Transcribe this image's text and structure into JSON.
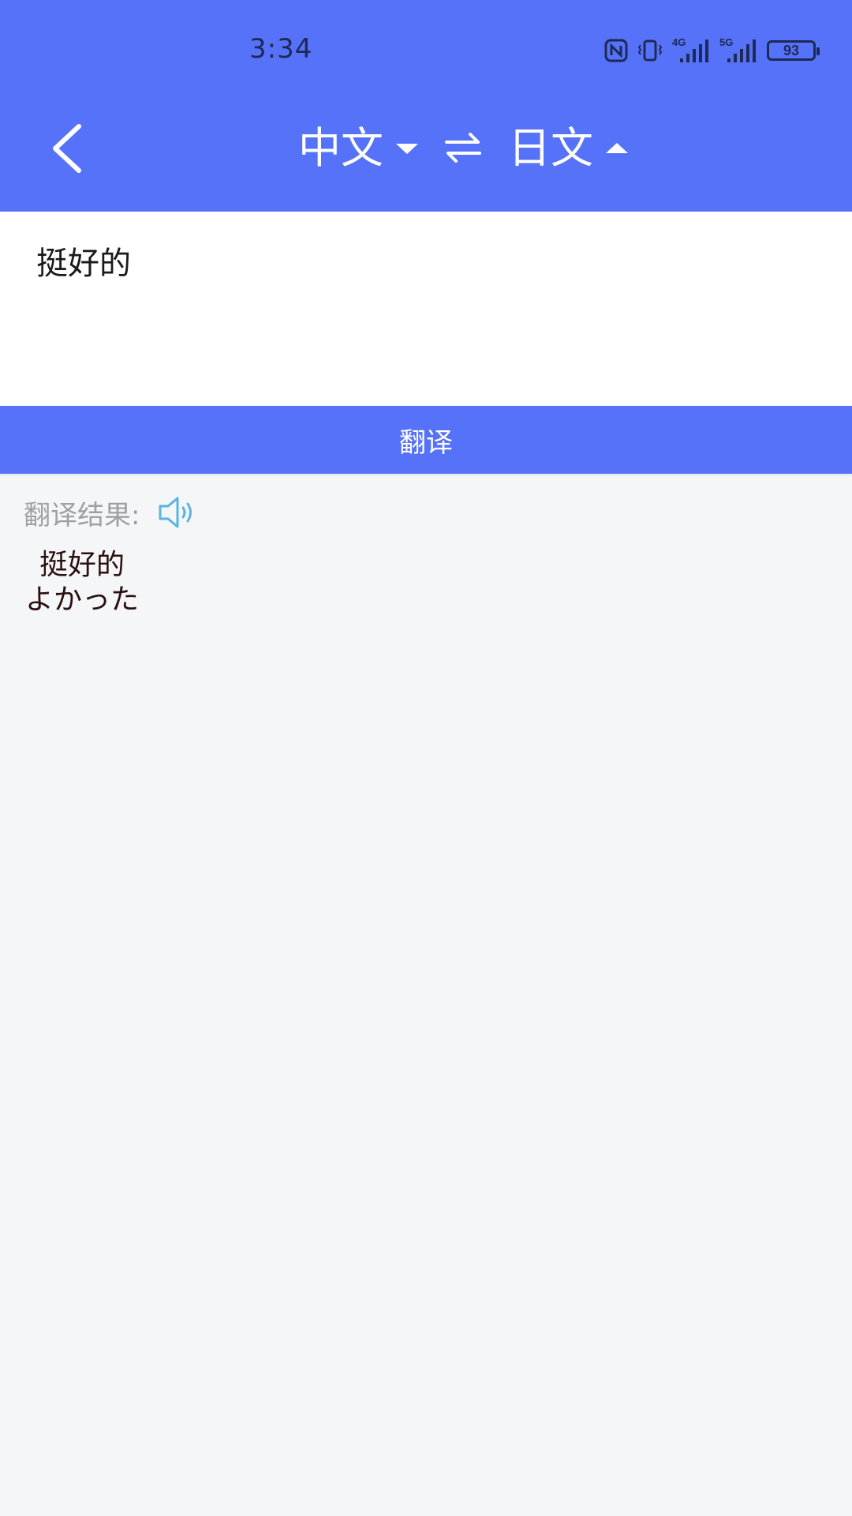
{
  "status_bar": {
    "time": "3:34",
    "battery": "93",
    "network_1": "4G",
    "network_2": "5G"
  },
  "nav": {
    "source_language": "中文",
    "target_language": "日文"
  },
  "input": {
    "text": "挺好的"
  },
  "translate_button": {
    "label": "翻译"
  },
  "result": {
    "label": "翻译结果:",
    "lines": [
      "挺好的",
      "よかった"
    ]
  },
  "colors": {
    "brand": "#5672f9",
    "background": "#f5f6f8",
    "speaker_icon": "#5ab4e0"
  }
}
